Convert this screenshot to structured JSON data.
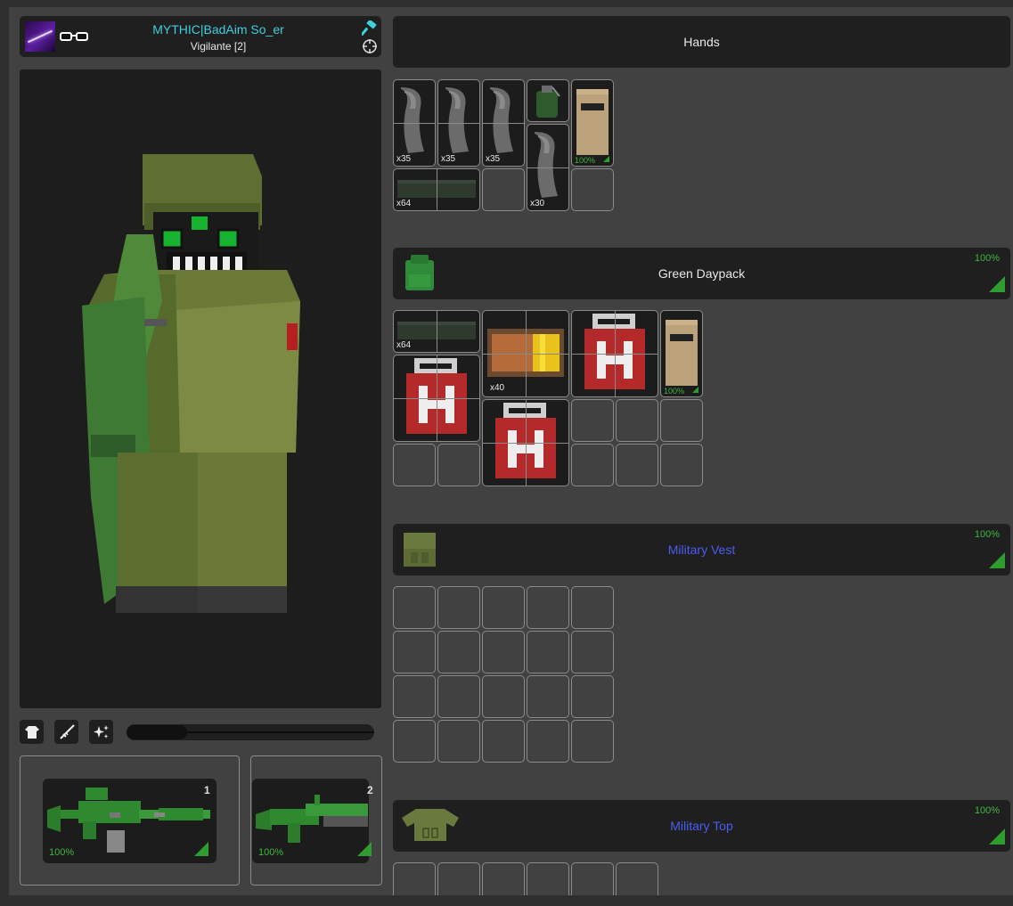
{
  "player": {
    "name": "MYTHIC|BadAim So_er",
    "group": "Vigilante [2]"
  },
  "icons": {
    "avatar": "avatar-image",
    "accessory": "glasses-icon",
    "admin": "hammer-icon",
    "target": "crosshair-icon",
    "clothing": "shirt-icon",
    "weapons": "rifle-icon",
    "effects": "sparkles-icon"
  },
  "zoom_level": 0.25,
  "weapons": [
    {
      "slot": "1",
      "durability": "100%"
    },
    {
      "slot": "2",
      "durability": "100%"
    }
  ],
  "hands": {
    "title": "Hands",
    "items": [
      {
        "name": "magazine",
        "amount": "x35"
      },
      {
        "name": "magazine",
        "amount": "x35"
      },
      {
        "name": "magazine",
        "amount": "x35"
      },
      {
        "name": "grenade",
        "amount": ""
      },
      {
        "name": "tactical-vest",
        "quality": "100%"
      },
      {
        "name": "ammo-box",
        "amount": "x64"
      },
      {
        "name": "magazine",
        "amount": "x30"
      }
    ]
  },
  "backpack": {
    "title": "Green Daypack",
    "quality": "100%",
    "items": [
      {
        "name": "ammo-box",
        "amount": "x64"
      },
      {
        "name": "ammo-crate",
        "amount": "x40"
      },
      {
        "name": "medkit",
        "amount": ""
      },
      {
        "name": "tactical-vest",
        "quality": "100%"
      },
      {
        "name": "medkit",
        "amount": ""
      },
      {
        "name": "medkit",
        "amount": ""
      }
    ]
  },
  "vest": {
    "title": "Military Vest",
    "quality": "100%"
  },
  "top": {
    "title": "Military Top",
    "quality": "100%"
  },
  "colors": {
    "accent_cyan": "#3fd0df",
    "quality_green": "#3fb640",
    "section_blue": "#4a5df2"
  }
}
